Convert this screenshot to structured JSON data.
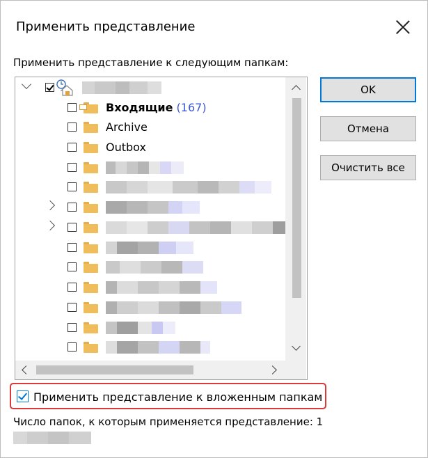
{
  "dialog": {
    "title": "Применить представление",
    "prompt": "Применить представление к следующим папкам:",
    "tree": {
      "root": {
        "checked": true,
        "expanded": true
      },
      "folders": [
        {
          "name": "Входящие",
          "count": "(167)",
          "bold": true,
          "checked": false,
          "icon": "inbox-folder-icon"
        },
        {
          "name": "Archive",
          "checked": false,
          "icon": "folder-icon"
        },
        {
          "name": "Outbox",
          "checked": false,
          "icon": "folder-icon"
        }
      ]
    },
    "buttons": {
      "ok": "OK",
      "cancel": "Отмена",
      "clear_all": "Очистить все"
    },
    "subfolders_option": {
      "label": "Применить представление к вложенным папкам",
      "checked": true
    },
    "status_text": "Число папок, к которым применяется представление: 1",
    "colors": {
      "accent": "#0078d7",
      "highlight_border": "#d93a3a",
      "count": "#3c58d6",
      "folder": "#f0bd5c"
    }
  }
}
